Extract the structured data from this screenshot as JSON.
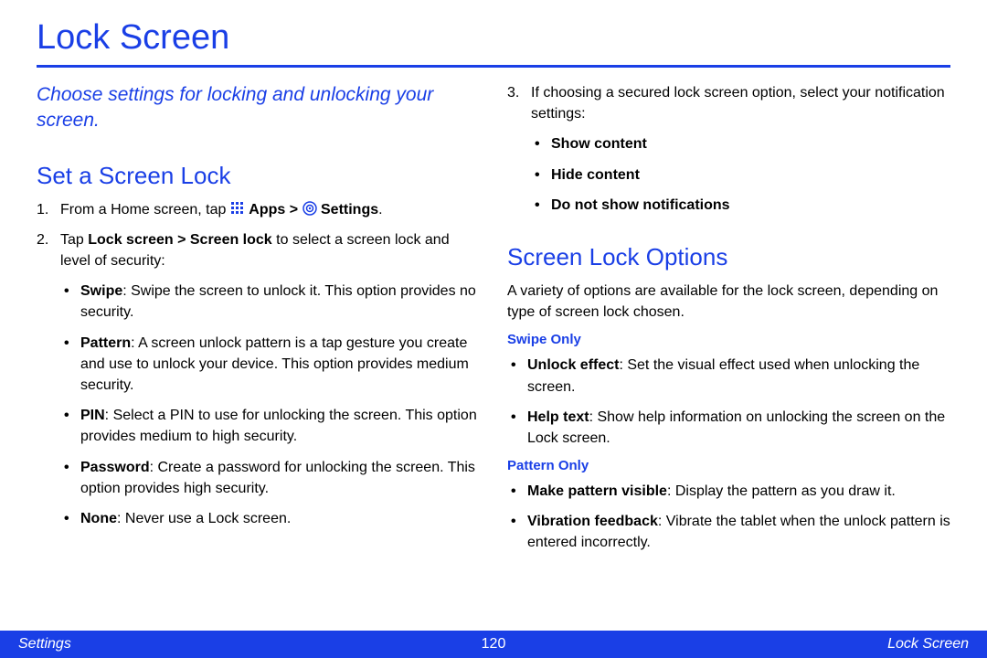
{
  "title": "Lock Screen",
  "intro": "Choose settings for locking and unlocking your screen.",
  "left": {
    "heading": "Set a Screen Lock",
    "step1_num": "1.",
    "step1_a": "From a Home screen, tap ",
    "step1_apps": "Apps",
    "step1_sep": " > ",
    "step1_settings": "Settings",
    "step1_end": ".",
    "step2_num": "2.",
    "step2_a": "Tap ",
    "step2_b": "Lock screen > Screen lock",
    "step2_c": " to select a screen lock and level of security:",
    "opts": {
      "swipe_b": "Swipe",
      "swipe_t": ": Swipe the screen to unlock it. This option provides no security.",
      "pattern_b": "Pattern",
      "pattern_t": ": A screen unlock pattern is a tap gesture you create and use to unlock your device. This option provides medium security.",
      "pin_b": "PIN",
      "pin_t": ": Select a PIN to use for unlocking the screen. This option provides medium to high security.",
      "password_b": "Password",
      "password_t": ": Create a password for unlocking the screen. This option provides high security.",
      "none_b": "None",
      "none_t": ": Never use a Lock screen."
    }
  },
  "right": {
    "step3_num": "3.",
    "step3_t": "If choosing a secured lock screen option, select your notification settings:",
    "notif": {
      "a": "Show content",
      "b": "Hide content",
      "c": "Do not show notifications"
    },
    "heading": "Screen Lock Options",
    "intro": "A variety of options are available for the lock screen, depending on type of screen lock chosen.",
    "swipe_h": "Swipe Only",
    "swipe": {
      "a_b": "Unlock effect",
      "a_t": ": Set the visual effect used when unlocking the screen.",
      "b_b": "Help text",
      "b_t": ": Show help information on unlocking the screen on the Lock screen."
    },
    "pattern_h": "Pattern Only",
    "pattern": {
      "a_b": "Make pattern visible",
      "a_t": ": Display the pattern as you draw it.",
      "b_b": "Vibration feedback",
      "b_t": ": Vibrate the tablet when the unlock pattern is entered incorrectly."
    }
  },
  "footer": {
    "left": "Settings",
    "center": "120",
    "right": "Lock Screen"
  }
}
